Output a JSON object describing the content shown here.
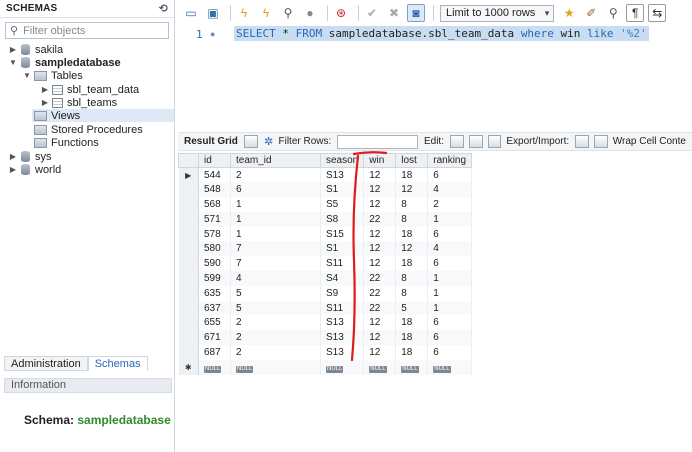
{
  "sidebar": {
    "title": "SCHEMAS",
    "filter_placeholder": "Filter objects",
    "tree": {
      "sakila": "sakila",
      "sampledatabase": "sampledatabase",
      "tables": "Tables",
      "table1": "sbl_team_data",
      "table2": "sbl_teams",
      "views": "Views",
      "procs": "Stored Procedures",
      "funcs": "Functions",
      "sys": "sys",
      "world": "world"
    },
    "tabs": [
      "Administration",
      "Schemas"
    ],
    "info_header": "Information",
    "schema_label": "Schema:",
    "schema_name": "sampledatabase"
  },
  "editor": {
    "limit_label": "Limit to 1000 rows",
    "line_number": "1",
    "sql": {
      "select": "SELECT",
      "star_from": " * ",
      "from": "FROM",
      "table": " sampledatabase.sbl_team_data ",
      "where": "where",
      "col": " win ",
      "like": "like",
      "pattern": " '%2'"
    }
  },
  "result_toolbar": {
    "result_grid": "Result Grid",
    "filter_rows": "Filter Rows:",
    "edit": "Edit:",
    "export": "Export/Import:",
    "wrap": "Wrap Cell Conte"
  },
  "grid": {
    "columns": [
      "id",
      "team_id",
      "season",
      "win",
      "lost",
      "ranking"
    ],
    "rows": [
      [
        "544",
        "2",
        "S13",
        "12",
        "18",
        "6"
      ],
      [
        "548",
        "6",
        "S1",
        "12",
        "12",
        "4"
      ],
      [
        "568",
        "1",
        "S5",
        "12",
        "8",
        "2"
      ],
      [
        "571",
        "1",
        "S8",
        "22",
        "8",
        "1"
      ],
      [
        "578",
        "1",
        "S15",
        "12",
        "18",
        "6"
      ],
      [
        "580",
        "7",
        "S1",
        "12",
        "12",
        "4"
      ],
      [
        "590",
        "7",
        "S11",
        "12",
        "18",
        "6"
      ],
      [
        "599",
        "4",
        "S4",
        "22",
        "8",
        "1"
      ],
      [
        "635",
        "5",
        "S9",
        "22",
        "8",
        "1"
      ],
      [
        "637",
        "5",
        "S11",
        "22",
        "5",
        "1"
      ],
      [
        "655",
        "2",
        "S13",
        "12",
        "18",
        "6"
      ],
      [
        "671",
        "2",
        "S13",
        "12",
        "18",
        "6"
      ],
      [
        "687",
        "2",
        "S13",
        "12",
        "18",
        "6"
      ]
    ],
    "null_label": "NULL",
    "current_row_marker": "▶",
    "new_row_marker": "✱"
  },
  "colors": {
    "keyword": "#2a67b3",
    "highlight": "#c8ddf2",
    "schema_green": "#2f8a2f",
    "annotation_red": "#e0191f"
  }
}
